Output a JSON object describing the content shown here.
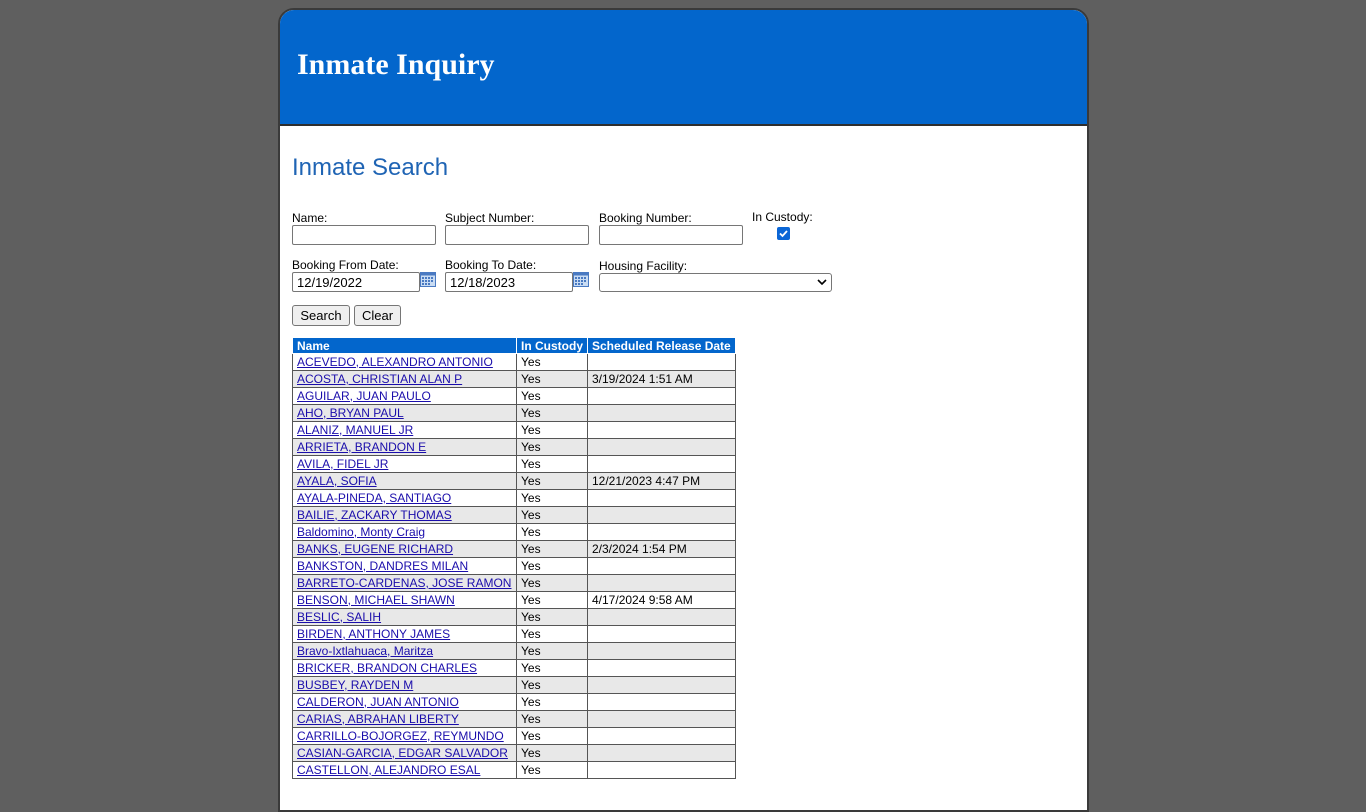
{
  "header": {
    "title": "Inmate Inquiry"
  },
  "search": {
    "title": "Inmate Search",
    "name_label": "Name:",
    "name_value": "",
    "subject_label": "Subject Number:",
    "subject_value": "",
    "booking_number_label": "Booking Number:",
    "booking_number_value": "",
    "in_custody_label": "In Custody:",
    "in_custody_checked": true,
    "from_date_label": "Booking From Date:",
    "from_date_value": "12/19/2022",
    "to_date_label": "Booking To Date:",
    "to_date_value": "12/18/2023",
    "facility_label": "Housing Facility:",
    "facility_value": "",
    "search_button": "Search",
    "clear_button": "Clear"
  },
  "results": {
    "columns": [
      "Name",
      "In Custody",
      "Scheduled Release Date"
    ],
    "rows": [
      {
        "name": "ACEVEDO, ALEXANDRO ANTONIO",
        "custody": "Yes",
        "release": ""
      },
      {
        "name": "ACOSTA, CHRISTIAN ALAN P",
        "custody": "Yes",
        "release": "3/19/2024 1:51 AM"
      },
      {
        "name": "AGUILAR, JUAN PAULO",
        "custody": "Yes",
        "release": ""
      },
      {
        "name": "AHO, BRYAN PAUL",
        "custody": "Yes",
        "release": ""
      },
      {
        "name": "ALANIZ, MANUEL JR",
        "custody": "Yes",
        "release": ""
      },
      {
        "name": "ARRIETA, BRANDON E",
        "custody": "Yes",
        "release": ""
      },
      {
        "name": "AVILA, FIDEL JR",
        "custody": "Yes",
        "release": ""
      },
      {
        "name": "AYALA, SOFIA",
        "custody": "Yes",
        "release": "12/21/2023 4:47 PM"
      },
      {
        "name": "AYALA-PINEDA, SANTIAGO",
        "custody": "Yes",
        "release": ""
      },
      {
        "name": "BAILIE, ZACKARY THOMAS",
        "custody": "Yes",
        "release": ""
      },
      {
        "name": "Baldomino, Monty Craig",
        "custody": "Yes",
        "release": ""
      },
      {
        "name": "BANKS, EUGENE RICHARD",
        "custody": "Yes",
        "release": "2/3/2024 1:54 PM"
      },
      {
        "name": "BANKSTON, DANDRES MILAN",
        "custody": "Yes",
        "release": ""
      },
      {
        "name": "BARRETO-CARDENAS, JOSE RAMON",
        "custody": "Yes",
        "release": ""
      },
      {
        "name": "BENSON, MICHAEL SHAWN",
        "custody": "Yes",
        "release": "4/17/2024 9:58 AM"
      },
      {
        "name": "BESLIC, SALIH",
        "custody": "Yes",
        "release": ""
      },
      {
        "name": "BIRDEN, ANTHONY JAMES",
        "custody": "Yes",
        "release": ""
      },
      {
        "name": "Bravo-Ixtlahuaca, Maritza",
        "custody": "Yes",
        "release": ""
      },
      {
        "name": "BRICKER, BRANDON CHARLES",
        "custody": "Yes",
        "release": ""
      },
      {
        "name": "BUSBEY, RAYDEN M",
        "custody": "Yes",
        "release": ""
      },
      {
        "name": "CALDERON, JUAN ANTONIO",
        "custody": "Yes",
        "release": ""
      },
      {
        "name": "CARIAS, ABRAHAN LIBERTY",
        "custody": "Yes",
        "release": ""
      },
      {
        "name": "CARRILLO-BOJORGEZ, REYMUNDO",
        "custody": "Yes",
        "release": ""
      },
      {
        "name": "CASIAN-GARCIA, EDGAR SALVADOR",
        "custody": "Yes",
        "release": ""
      },
      {
        "name": "CASTELLON, ALEJANDRO ESAL",
        "custody": "Yes",
        "release": ""
      }
    ]
  }
}
